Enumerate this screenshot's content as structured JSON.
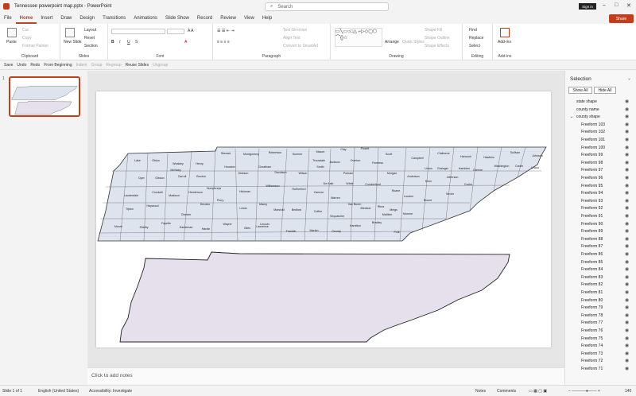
{
  "window": {
    "title": "Tennessee powerpoint map.pptx  -  PowerPoint",
    "search_placeholder": "Search",
    "signin": "Sign in",
    "share": "Share"
  },
  "menu": [
    "File",
    "Home",
    "Insert",
    "Draw",
    "Design",
    "Transitions",
    "Animations",
    "Slide Show",
    "Record",
    "Review",
    "View",
    "Help"
  ],
  "ribbon": {
    "clipboard": {
      "paste": "Paste",
      "cut": "Cut",
      "copy": "Copy",
      "format_painter": "Format Painter",
      "label": "Clipboard"
    },
    "slides": {
      "new_slide": "New Slide",
      "layout": "Layout",
      "reset": "Reset",
      "section": "Section",
      "label": "Slides"
    },
    "font": {
      "label": "Font"
    },
    "paragraph": {
      "text_direction": "Text Direction",
      "align_text": "Align Text",
      "smartart": "Convert to SmartArt",
      "label": "Paragraph"
    },
    "drawing": {
      "arrange": "Arrange",
      "quick_styles": "Quick Styles",
      "shape_fill": "Shape Fill",
      "shape_outline": "Shape Outline",
      "shape_effects": "Shape Effects",
      "label": "Drawing"
    },
    "editing": {
      "find": "Find",
      "replace": "Replace",
      "select": "Select",
      "label": "Editing"
    },
    "addins": {
      "addins": "Add-ins",
      "label": "Add-ins"
    }
  },
  "qat": {
    "save": "Save",
    "undo": "Undo",
    "redo": "Redo",
    "from_beginning": "From Beginning",
    "indent": "Indent",
    "group": "Group",
    "regroup": "Regroup",
    "reuse": "Reuse Slides",
    "ungroup": "Ungroup"
  },
  "thumbnail": {
    "slide_number": "1"
  },
  "notes_placeholder": "Click to add notes",
  "selection_pane": {
    "title": "Selection",
    "show_all": "Show All",
    "hide_all": "Hide All",
    "items": [
      "state shape",
      "county name",
      "county shape",
      "Freeform 103",
      "Freeform 102",
      "Freeform 101",
      "Freeform 100",
      "Freeform 99",
      "Freeform 98",
      "Freeform 97",
      "Freeform 96",
      "Freeform 95",
      "Freeform 94",
      "Freeform 93",
      "Freeform 92",
      "Freeform 91",
      "Freeform 90",
      "Freeform 89",
      "Freeform 88",
      "Freeform 87",
      "Freeform 86",
      "Freeform 85",
      "Freeform 84",
      "Freeform 83",
      "Freeform 82",
      "Freeform 81",
      "Freeform 80",
      "Freeform 79",
      "Freeform 78",
      "Freeform 77",
      "Freeform 76",
      "Freeform 75",
      "Freeform 74",
      "Freeform 73",
      "Freeform 72",
      "Freeform 71"
    ]
  },
  "counties": [
    "Lake",
    "Obion",
    "Weakley",
    "Henry",
    "Stewart",
    "Montgomery",
    "Robertson",
    "Sumner",
    "Macon",
    "Clay",
    "Pickett",
    "Scott",
    "Campbell",
    "Claiborne",
    "Hancock",
    "Hawkins",
    "Sullivan",
    "Johnson",
    "Dyer",
    "Gibson",
    "Carroll",
    "Benton",
    "Houston",
    "Dickson",
    "Cheatham",
    "Davidson",
    "Wilson",
    "Smith",
    "Trousdale",
    "Jackson",
    "Overton",
    "Fentress",
    "Morgan",
    "Anderson",
    "Union",
    "Grainger",
    "Hamblen",
    "Greene",
    "Washington",
    "Carter",
    "Unicoi",
    "Lauderdale",
    "Crockett",
    "Madison",
    "Henderson",
    "Decatur",
    "Perry",
    "Humphreys",
    "Hickman",
    "Williamson",
    "Rutherford",
    "Cannon",
    "De Kalb",
    "White",
    "Putnam",
    "Cumberland",
    "Roane",
    "Knox",
    "Jefferson",
    "Cocke",
    "Sevier",
    "Blount",
    "Loudon",
    "Tipton",
    "Haywood",
    "Chester",
    "Hardin",
    "Wayne",
    "Lewis",
    "Maury",
    "Marshall",
    "Bedford",
    "Coffee",
    "Warren",
    "Van Buren",
    "Bledsoe",
    "Rhea",
    "Meigs",
    "McMinn",
    "Monroe",
    "Polk",
    "Bradley",
    "Hamilton",
    "Sequatchie",
    "Grundy",
    "Marion",
    "Franklin",
    "Lincoln",
    "Giles",
    "Lawrence",
    "Moore",
    "Shelby",
    "Fayette",
    "Hardeman",
    "McNairy"
  ],
  "status": {
    "slide": "Slide 1 of 1",
    "language": "English (United States)",
    "accessibility": "Accessibility: Investigate",
    "notes": "Notes",
    "comments": "Comments",
    "zoom": "140"
  }
}
